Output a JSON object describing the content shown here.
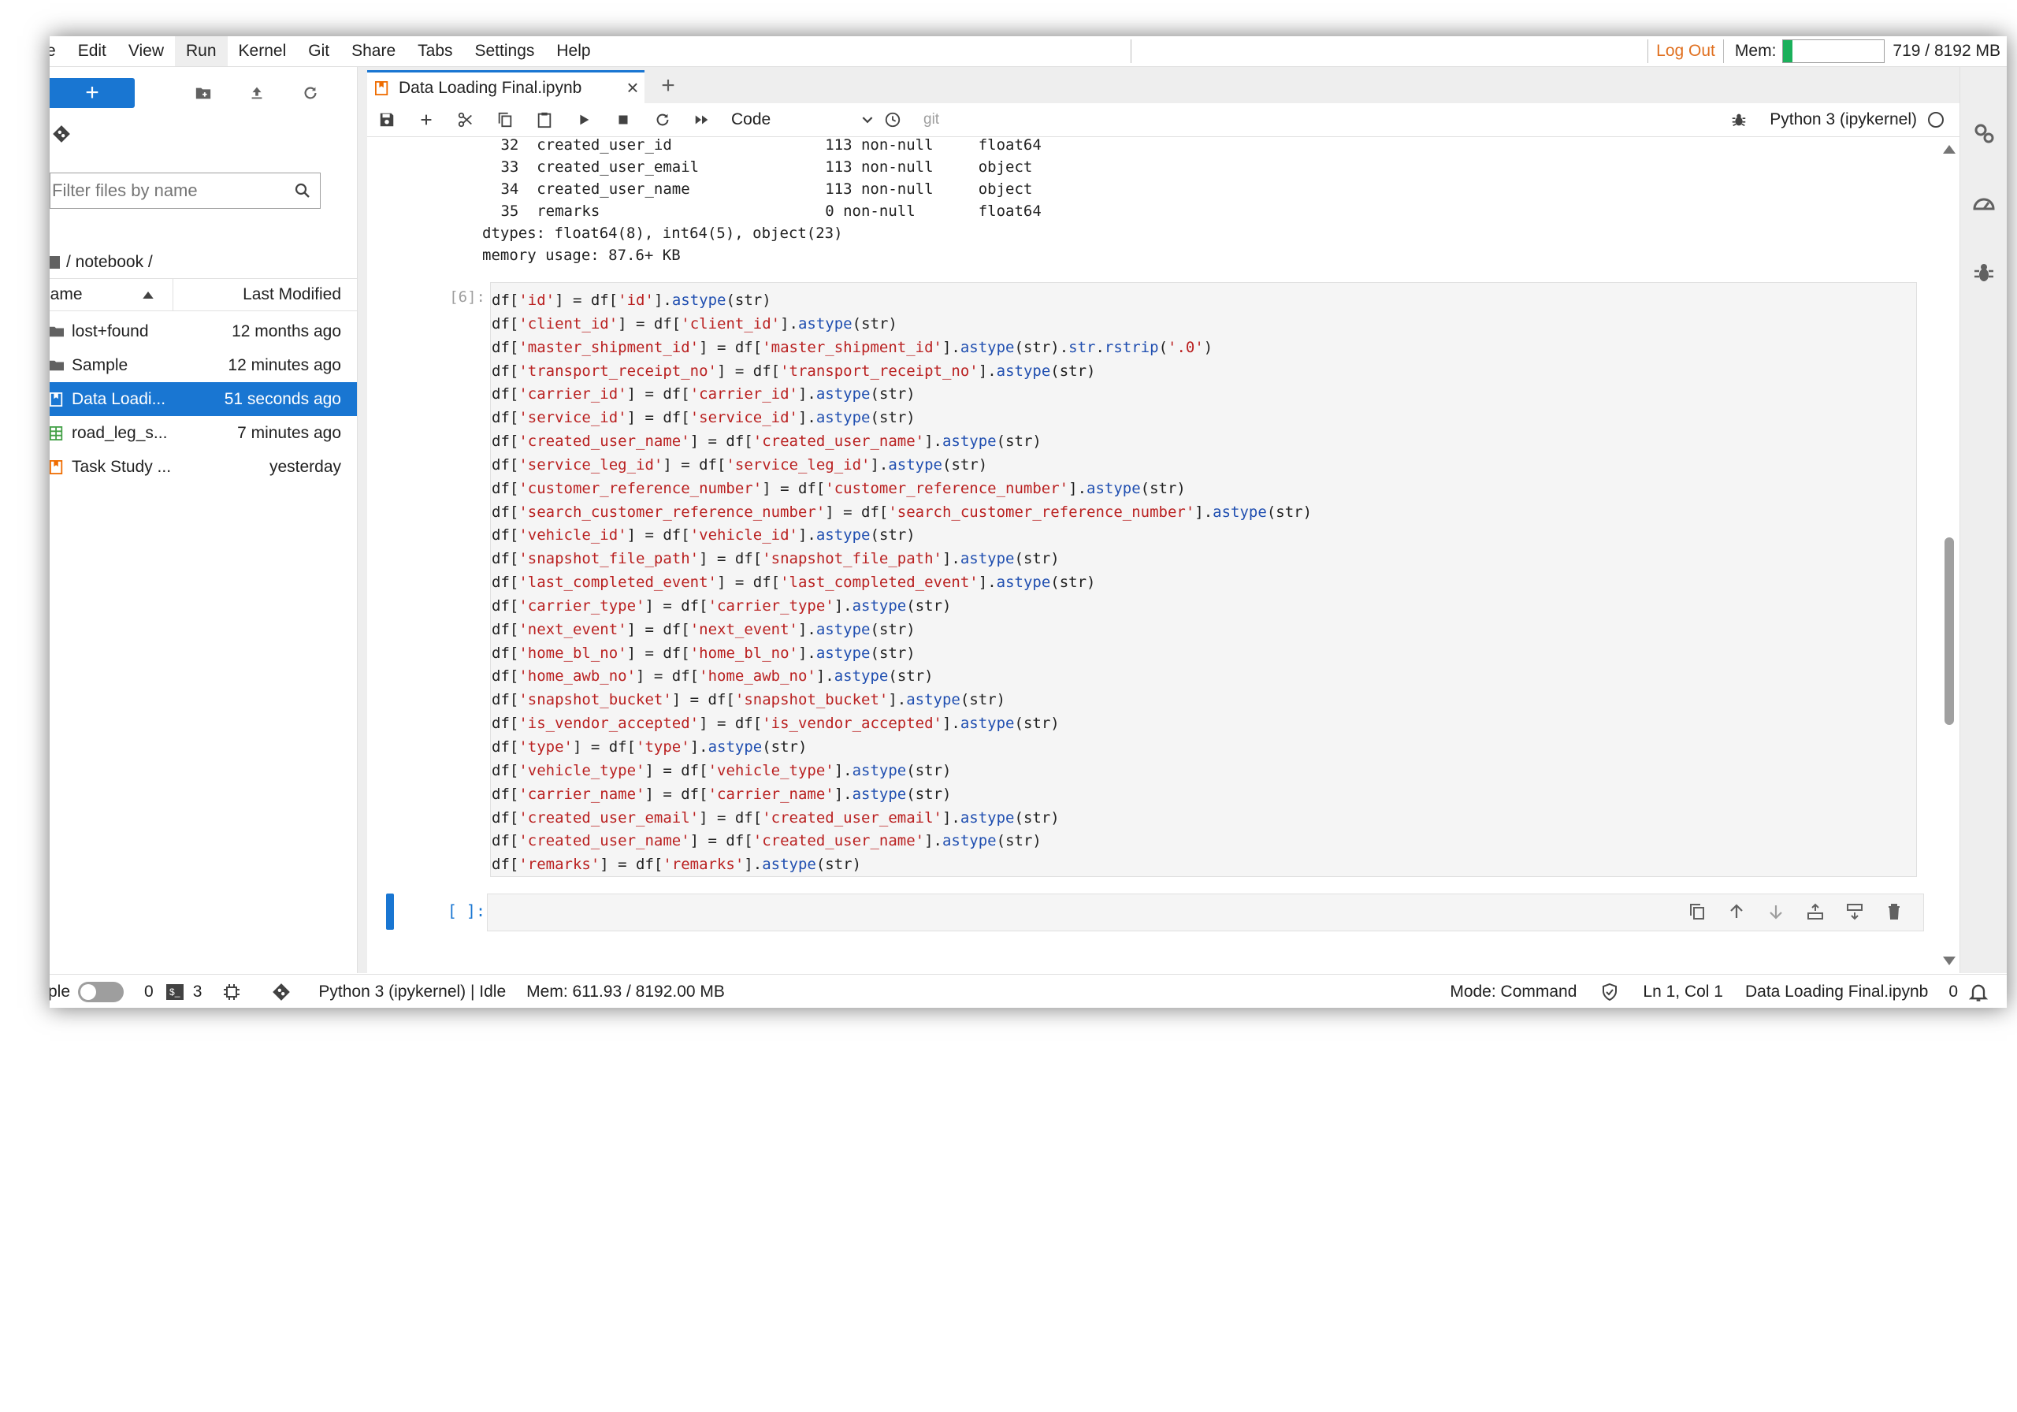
{
  "menubar": {
    "items": [
      "e",
      "Edit",
      "View",
      "Run",
      "Kernel",
      "Git",
      "Share",
      "Tabs",
      "Settings",
      "Help"
    ],
    "active_item": "Run",
    "logout": "Log Out",
    "mem_label": "Mem:",
    "mem_fraction": 0.0878,
    "mem_text": "719 / 8192 MB"
  },
  "filebrowser": {
    "new_label": "+",
    "filter_placeholder": "Filter files by name",
    "breadcrumb": "/ notebook /",
    "col_name": "lame",
    "col_modified": "Last Modified",
    "files": [
      {
        "name": "lost+found",
        "modified": "12 months ago",
        "kind": "folder-icon"
      },
      {
        "name": "Sample",
        "modified": "12 minutes ago",
        "kind": "folder-icon"
      },
      {
        "name": "Data Loadi...",
        "modified": "51 seconds ago",
        "kind": "notebook-icon",
        "selected": true
      },
      {
        "name": "road_leg_s...",
        "modified": "7 minutes ago",
        "kind": "spreadsheet-icon"
      },
      {
        "name": "Task Study ...",
        "modified": "yesterday",
        "kind": "notebook-icon"
      }
    ]
  },
  "tab": {
    "title": "Data Loading Final.ipynb",
    "close": "×",
    "add": "+"
  },
  "toolbar": {
    "cell_type": "Code",
    "git": "git",
    "kernel": "Python 3 (ipykernel)"
  },
  "output": {
    "lines": [
      " 32  created_user_id                 113 non-null     float64",
      " 33  created_user_email              113 non-null     object",
      " 34  created_user_name               113 non-null     object",
      " 35  remarks                         0 non-null       float64",
      "dtypes: float64(8), int64(5), object(23)",
      "memory usage: 87.6+ KB"
    ]
  },
  "cell": {
    "prompt": "[6]:",
    "lines": [
      "df['id'] = df['id'].astype(str)",
      "df['client_id'] = df['client_id'].astype(str)",
      "df['master_shipment_id'] = df['master_shipment_id'].astype(str).str.rstrip('.0')",
      "df['transport_receipt_no'] = df['transport_receipt_no'].astype(str)",
      "df['carrier_id'] = df['carrier_id'].astype(str)",
      "df['service_id'] = df['service_id'].astype(str)",
      "df['created_user_name'] = df['created_user_name'].astype(str)",
      "df['service_leg_id'] = df['service_leg_id'].astype(str)",
      "df['customer_reference_number'] = df['customer_reference_number'].astype(str)",
      "df['search_customer_reference_number'] = df['search_customer_reference_number'].astype(str)",
      "df['vehicle_id'] = df['vehicle_id'].astype(str)",
      "df['snapshot_file_path'] = df['snapshot_file_path'].astype(str)",
      "df['last_completed_event'] = df['last_completed_event'].astype(str)",
      "df['carrier_type'] = df['carrier_type'].astype(str)",
      "df['next_event'] = df['next_event'].astype(str)",
      "df['home_bl_no'] = df['home_bl_no'].astype(str)",
      "df['home_awb_no'] = df['home_awb_no'].astype(str)",
      "df['snapshot_bucket'] = df['snapshot_bucket'].astype(str)",
      "df['is_vendor_accepted'] = df['is_vendor_accepted'].astype(str)",
      "df['type'] = df['type'].astype(str)",
      "df['vehicle_type'] = df['vehicle_type'].astype(str)",
      "df['carrier_name'] = df['carrier_name'].astype(str)",
      "df['created_user_email'] = df['created_user_email'].astype(str)",
      "df['created_user_name'] = df['created_user_name'].astype(str)",
      "df['remarks'] = df['remarks'].astype(str)"
    ],
    "empty_prompt": "[ ]:"
  },
  "statusbar": {
    "simple_label": "ple",
    "kernels_count": "0",
    "terminal_glyph": "$_",
    "terminals_count": "3",
    "kernel_status": "Python 3 (ipykernel) | Idle",
    "mem": "Mem: 611.93 / 8192.00 MB",
    "mode": "Mode: Command",
    "cursor": "Ln 1, Col 1",
    "filename": "Data Loading Final.ipynb",
    "notifications": "0"
  },
  "colors": {
    "accent": "#1976d2",
    "string": "#ba2121",
    "method": "#1f4eb0",
    "logout": "#e07020",
    "mem_fill": "#1bb05b"
  }
}
